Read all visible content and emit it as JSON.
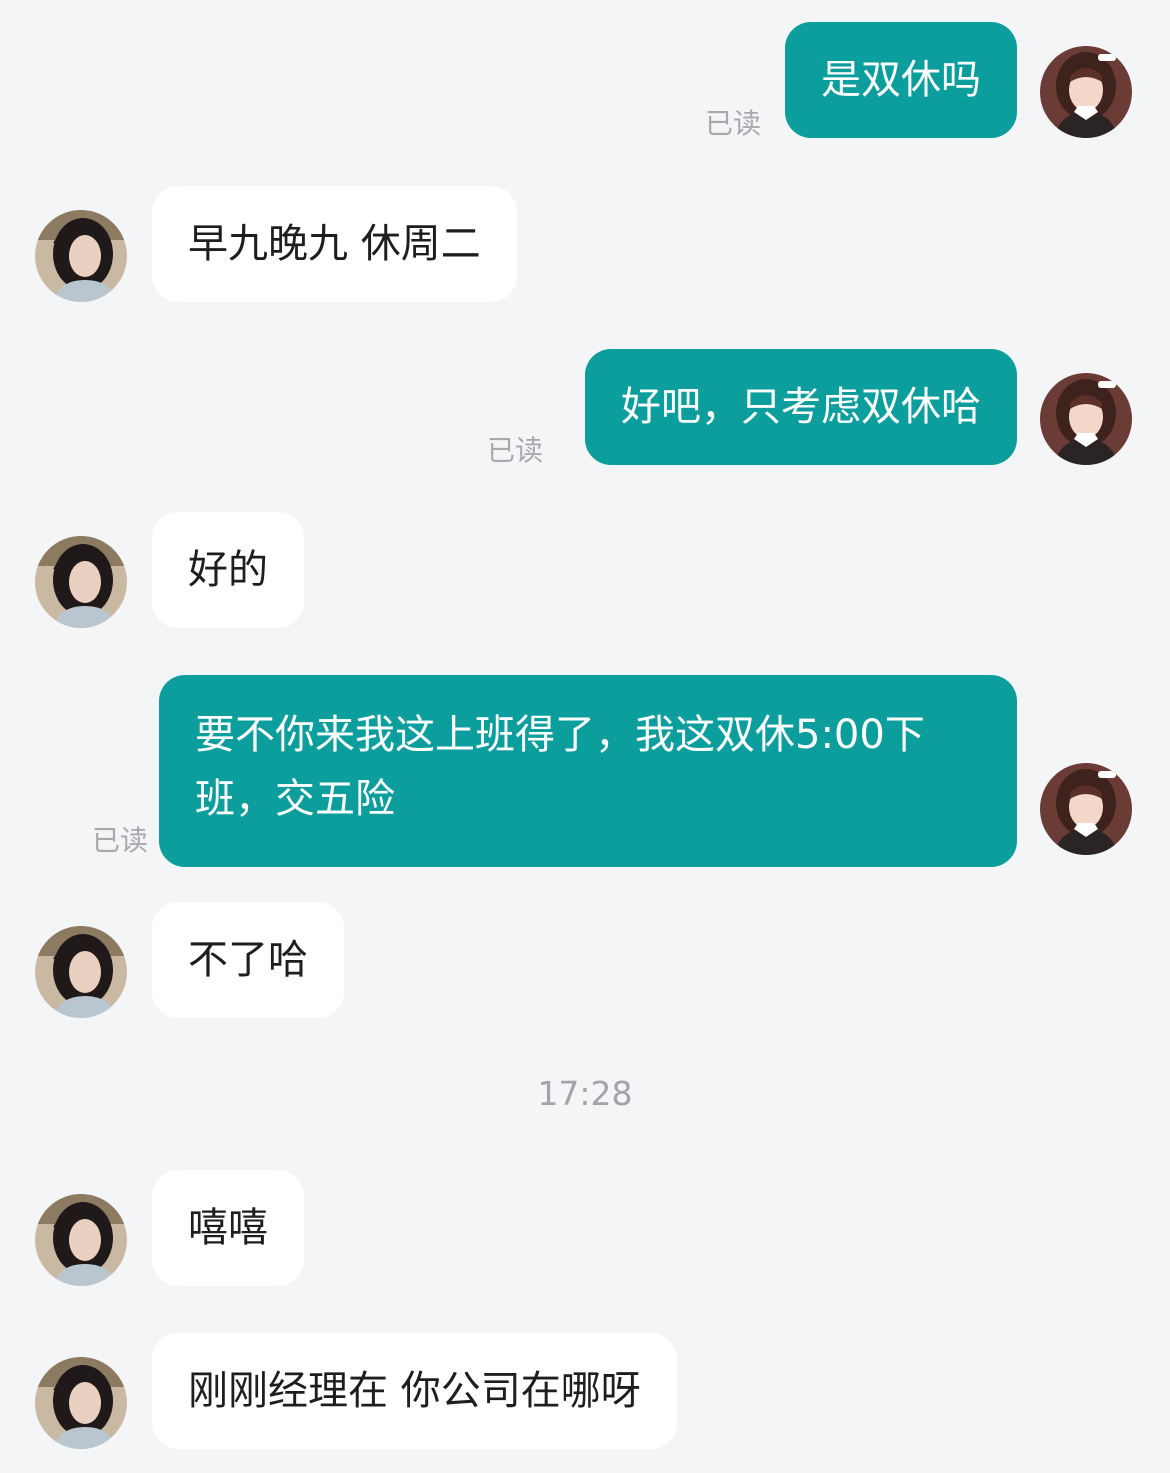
{
  "read_label": "已读",
  "timestamp": "17:28",
  "messages": [
    {
      "side": "me",
      "text": "是双休吗",
      "read": "已读"
    },
    {
      "side": "them",
      "text": "早九晚九 休周二"
    },
    {
      "side": "me",
      "text": "好吧，只考虑双休哈",
      "read": "已读"
    },
    {
      "side": "them",
      "text": "好的"
    },
    {
      "side": "me",
      "text": "要不你来我这上班得了，我这双休5:00下班，交五险",
      "read": "已读"
    },
    {
      "side": "them",
      "text": "不了哈"
    },
    {
      "side": "them",
      "text": "嘻嘻"
    },
    {
      "side": "them",
      "text": "刚刚经理在 你公司在哪呀"
    }
  ],
  "colors": {
    "background": "#f4f5f7",
    "outgoing_bubble": "#0b9e9c",
    "incoming_bubble": "#ffffff",
    "read_text": "#a9a9ad"
  },
  "icons": {
    "my_avatar": "avatar-me-icon",
    "their_avatar": "avatar-contact-icon"
  }
}
